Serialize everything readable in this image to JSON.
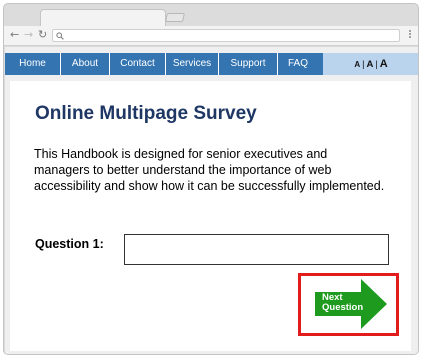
{
  "browser": {
    "address_value": ""
  },
  "nav": {
    "items": [
      "Home",
      "About",
      "Contact",
      "Services",
      "Support",
      "FAQ"
    ],
    "text_size": {
      "small": "A",
      "medium": "A",
      "large": "A"
    }
  },
  "page": {
    "title": "Online Multipage Survey",
    "description": "This Handbook is designed for senior executives and managers to better understand the importance of web accessibility and show how it can be successfully implemented.",
    "question_label": "Question 1:",
    "answer_value": "",
    "next_button_line1": "Next",
    "next_button_line2": "Question"
  },
  "colors": {
    "nav_background": "#3374b1",
    "title": "#1f3764",
    "next_button": "#1e9b1e",
    "highlight_outline": "#e21b1b"
  }
}
